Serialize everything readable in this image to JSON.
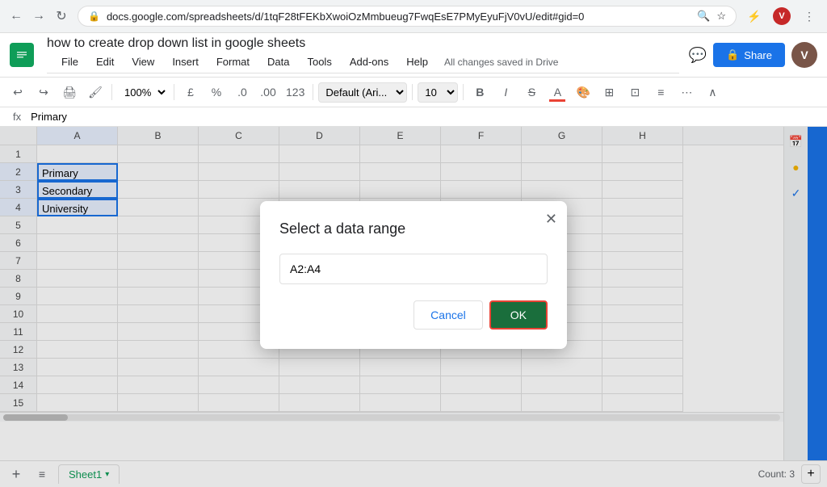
{
  "browser": {
    "url": "docs.google.com/spreadsheets/d/1tqF28tFEKbXwoiOzMmbueug7FwqEsE7PMyEyuFjV0vU/edit#gid=0",
    "back_btn": "◀",
    "forward_btn": "▶",
    "refresh_btn": "↻"
  },
  "app": {
    "logo": "≡",
    "title": "how to create drop down list in google sheets",
    "saved_text": "All changes saved in Drive",
    "share_label": "Share",
    "menu_items": [
      "File",
      "Edit",
      "View",
      "Insert",
      "Format",
      "Data",
      "Tools",
      "Add-ons",
      "Help"
    ]
  },
  "toolbar": {
    "zoom": "100%",
    "currency": "£",
    "percent": "%",
    "decimal1": ".0",
    "decimal2": ".00",
    "more_formats": "123",
    "font": "Default (Ari...",
    "font_size": "10",
    "bold": "B",
    "italic": "I",
    "strikethrough": "S",
    "underline": "A"
  },
  "formula_bar": {
    "icon": "fx",
    "value": "Primary"
  },
  "columns": [
    "A",
    "B",
    "C",
    "D",
    "E",
    "F",
    "G",
    "H"
  ],
  "rows": [
    {
      "num": "1",
      "cells": [
        "",
        "",
        "",
        "",
        "",
        "",
        "",
        ""
      ]
    },
    {
      "num": "2",
      "cells": [
        "Primary",
        "",
        "",
        "",
        "",
        "",
        "",
        ""
      ]
    },
    {
      "num": "3",
      "cells": [
        "Secondary",
        "",
        "",
        "",
        "",
        "",
        "",
        ""
      ]
    },
    {
      "num": "4",
      "cells": [
        "University",
        "",
        "",
        "",
        "",
        "",
        "",
        ""
      ]
    },
    {
      "num": "5",
      "cells": [
        "",
        "",
        "",
        "",
        "",
        "",
        "",
        ""
      ]
    },
    {
      "num": "6",
      "cells": [
        "",
        "",
        "",
        "",
        "",
        "",
        "",
        ""
      ]
    },
    {
      "num": "7",
      "cells": [
        "",
        "",
        "",
        "",
        "",
        "",
        "",
        ""
      ]
    },
    {
      "num": "8",
      "cells": [
        "",
        "",
        "",
        "",
        "",
        "",
        "",
        ""
      ]
    },
    {
      "num": "9",
      "cells": [
        "",
        "",
        "",
        "",
        "",
        "",
        "",
        ""
      ]
    },
    {
      "num": "10",
      "cells": [
        "",
        "",
        "",
        "",
        "",
        "",
        "",
        ""
      ]
    },
    {
      "num": "11",
      "cells": [
        "",
        "",
        "",
        "",
        "",
        "",
        "",
        ""
      ]
    },
    {
      "num": "12",
      "cells": [
        "",
        "",
        "",
        "",
        "",
        "",
        "",
        ""
      ]
    },
    {
      "num": "13",
      "cells": [
        "",
        "",
        "",
        "",
        "",
        "",
        "",
        ""
      ]
    },
    {
      "num": "14",
      "cells": [
        "",
        "",
        "",
        "",
        "",
        "",
        "",
        ""
      ]
    },
    {
      "num": "15",
      "cells": [
        "",
        "",
        "",
        "",
        "",
        "",
        "",
        ""
      ]
    }
  ],
  "dialog": {
    "title": "Select a data range",
    "input_value": "A2:A4",
    "cancel_label": "Cancel",
    "ok_label": "OK"
  },
  "bottom": {
    "sheet_name": "Sheet1",
    "count_text": "Count: 3"
  }
}
